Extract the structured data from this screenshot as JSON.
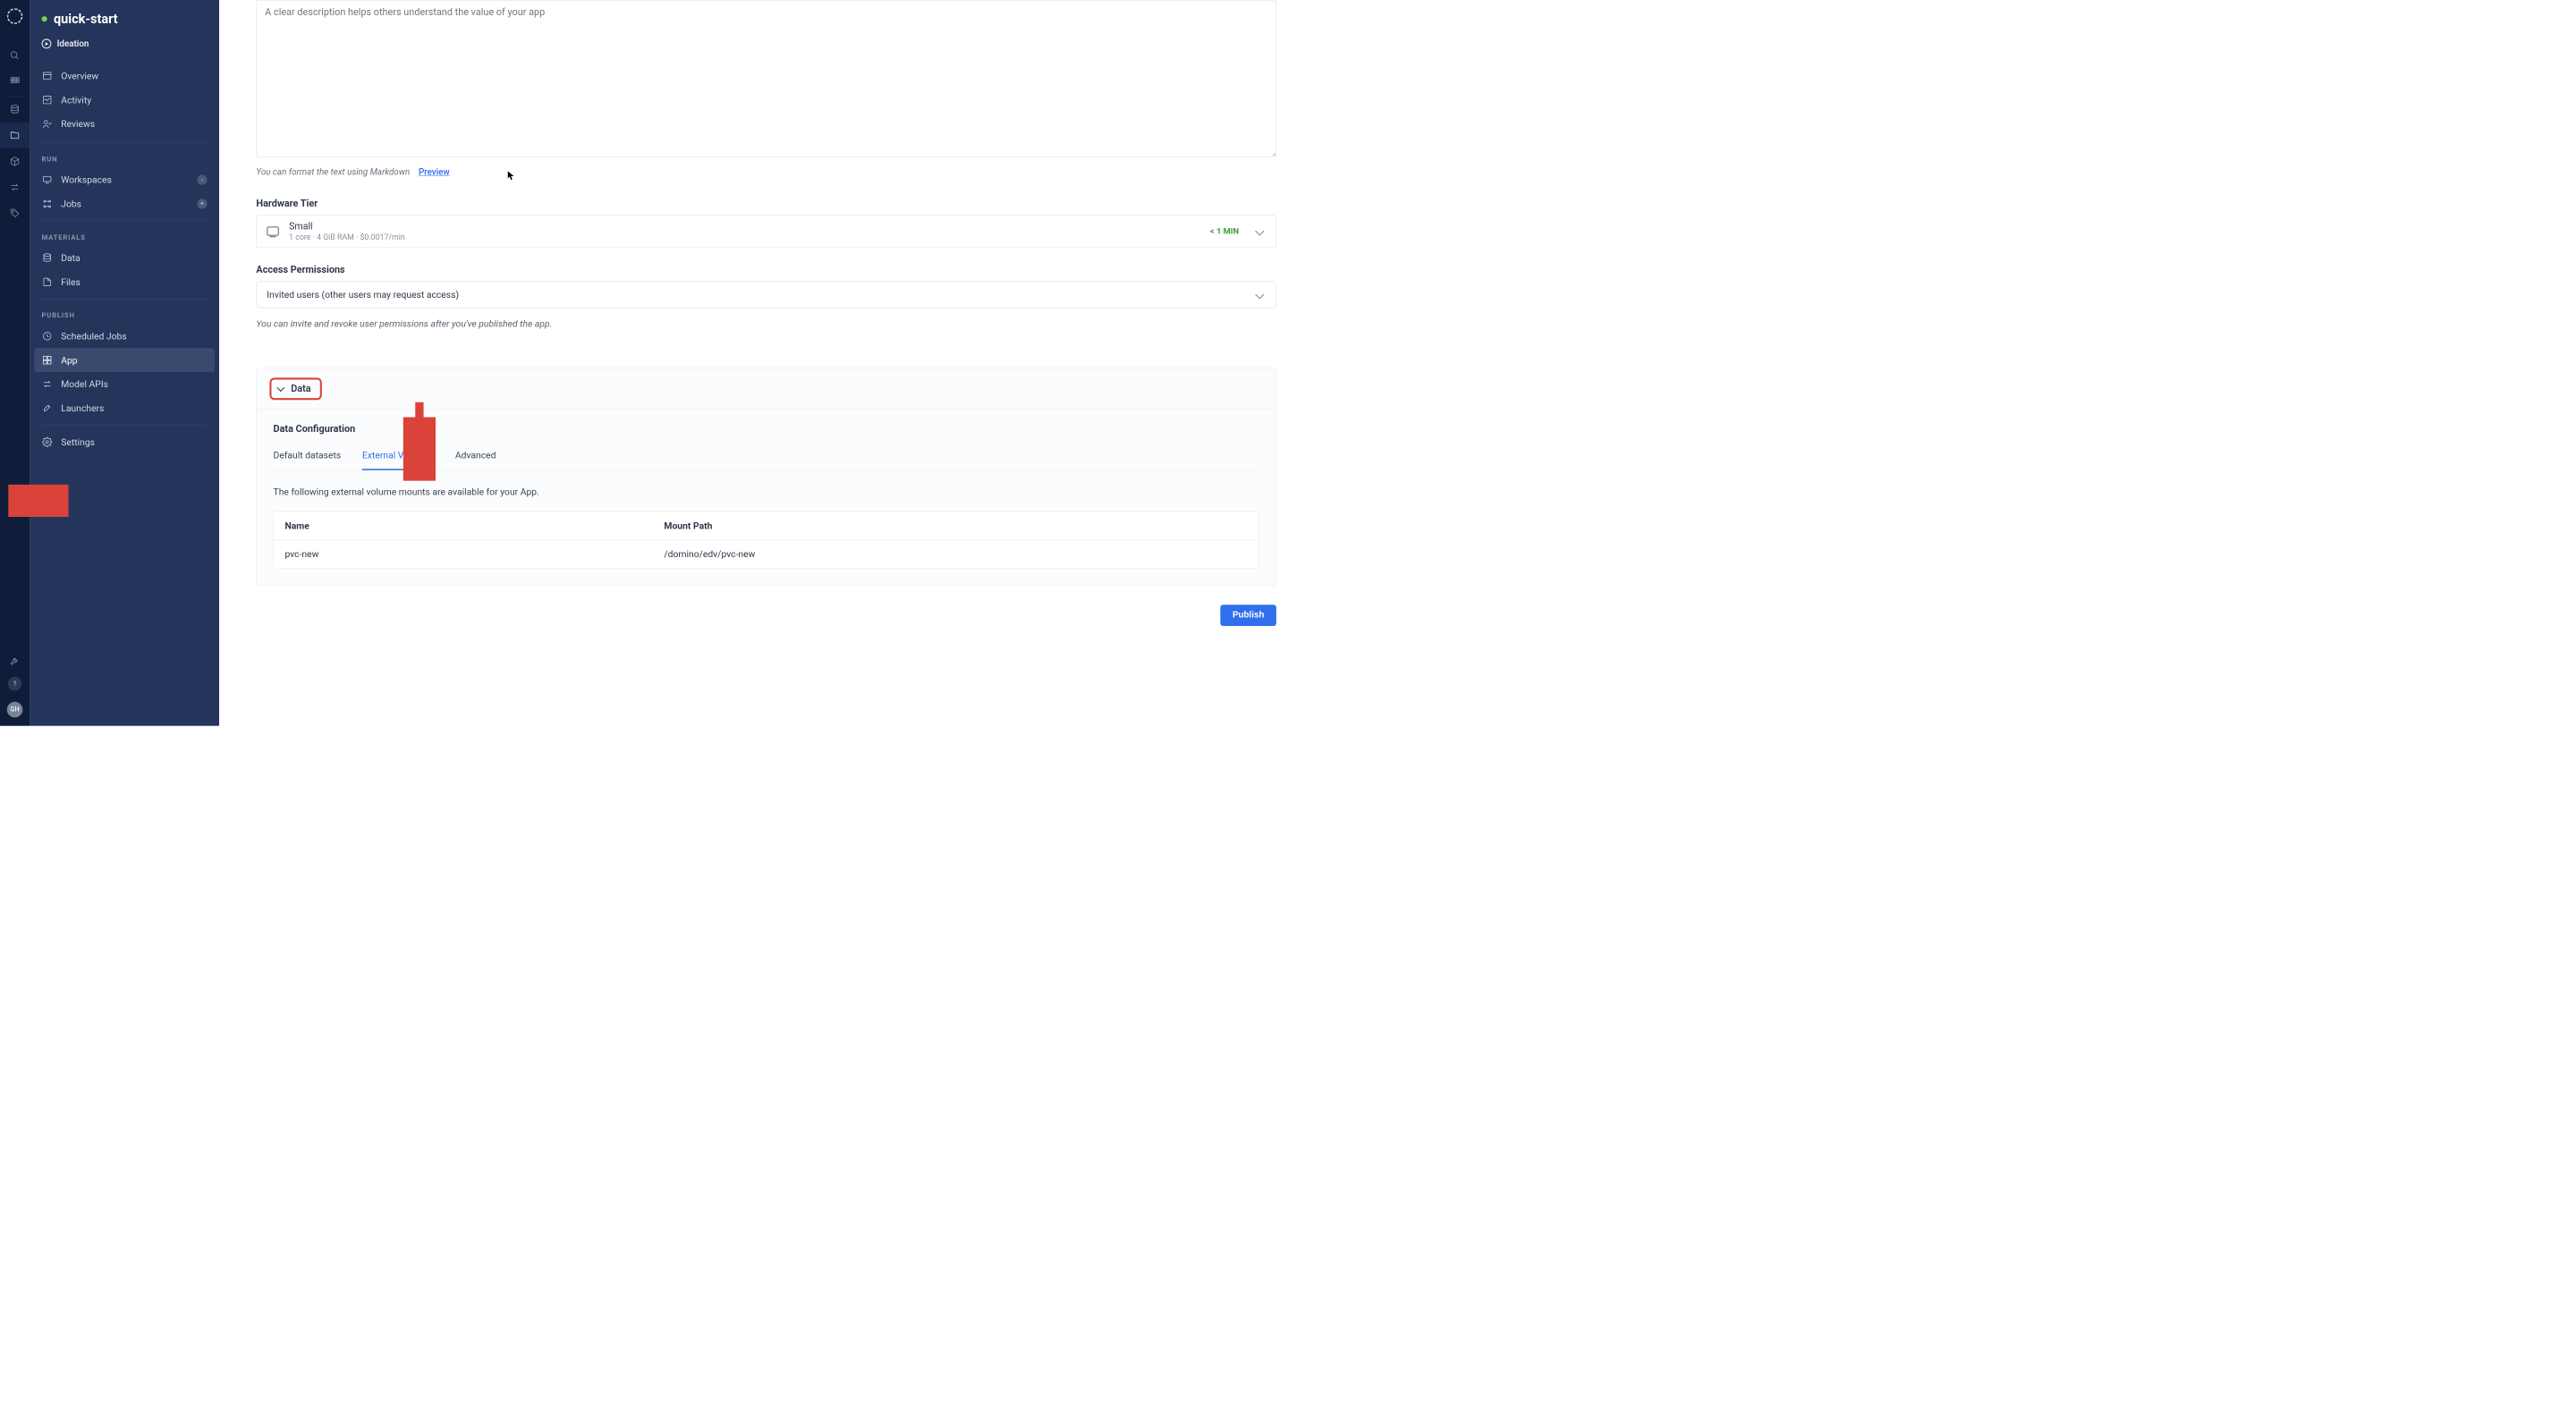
{
  "rail": {
    "avatar_initials": "GH"
  },
  "sidebar": {
    "project_name": "quick-start",
    "stage_label": "Ideation",
    "nav": {
      "overview": "Overview",
      "activity": "Activity",
      "reviews": "Reviews"
    },
    "sections": {
      "run": "RUN",
      "materials": "MATERIALS",
      "publish": "PUBLISH"
    },
    "run": {
      "workspaces": "Workspaces",
      "jobs": "Jobs"
    },
    "materials": {
      "data": "Data",
      "files": "Files"
    },
    "publish": {
      "scheduled_jobs": "Scheduled Jobs",
      "app": "App",
      "model_apis": "Model APIs",
      "launchers": "Launchers"
    },
    "settings": "Settings"
  },
  "main": {
    "description_placeholder": "A clear description helps others understand the value of your app",
    "markdown_hint": "You can format the text using Markdown",
    "preview_link": "Preview",
    "hardware_tier_label": "Hardware Tier",
    "hardware_tier": {
      "name": "Small",
      "detail": "1 core · 4 GiB RAM · $0.0017/min",
      "eta": "< 1 MIN"
    },
    "access_label": "Access Permissions",
    "access_value": "Invited users (other users may request access)",
    "access_hint": "You can invite and revoke user permissions after you've published the app.",
    "data_section_label": "Data",
    "data_config_title": "Data Configuration",
    "tabs": {
      "default": "Default datasets",
      "external": "External Volumes",
      "advanced": "Advanced"
    },
    "external_volumes_desc": "The following external volume mounts are available for your App.",
    "vol_headers": {
      "name": "Name",
      "path": "Mount Path"
    },
    "volumes": [
      {
        "name": "pvc-new",
        "path": "/domino/edv/pvc-new"
      }
    ],
    "publish_button": "Publish"
  },
  "colors": {
    "accent": "#2f6fed",
    "annotation": "#d9433a",
    "sidebar_bg": "#24345a",
    "rail_bg": "#0f1d3a",
    "success": "#3a9a3a"
  }
}
